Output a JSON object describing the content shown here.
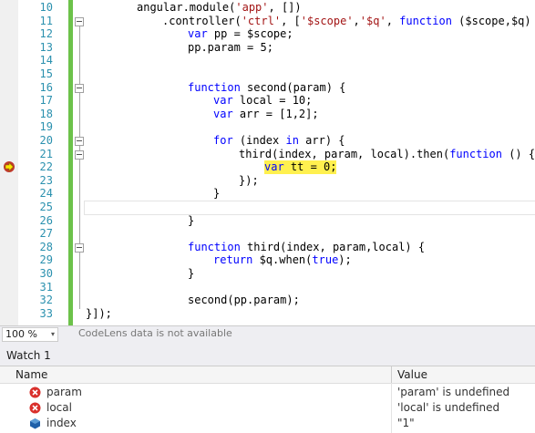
{
  "editor": {
    "lines": [
      {
        "n": "10"
      },
      {
        "n": "11"
      },
      {
        "n": "12"
      },
      {
        "n": "13"
      },
      {
        "n": "14"
      },
      {
        "n": "15"
      },
      {
        "n": "16"
      },
      {
        "n": "17"
      },
      {
        "n": "18"
      },
      {
        "n": "19"
      },
      {
        "n": "20"
      },
      {
        "n": "21"
      },
      {
        "n": "22"
      },
      {
        "n": "23"
      },
      {
        "n": "24"
      },
      {
        "n": "25"
      },
      {
        "n": "26"
      },
      {
        "n": "27"
      },
      {
        "n": "28"
      },
      {
        "n": "29"
      },
      {
        "n": "30"
      },
      {
        "n": "31"
      },
      {
        "n": "32"
      },
      {
        "n": "33"
      }
    ],
    "code": {
      "l10": [
        "angular.module(",
        "'app'",
        ", [])"
      ],
      "l11": [
        ".controller(",
        "'ctrl'",
        ", [",
        "'$scope'",
        ",",
        "'$q'",
        ", ",
        "function",
        " ($scope,$q) {"
      ],
      "l12": [
        "var",
        " pp = $scope;"
      ],
      "l13": [
        "pp.param = 5;"
      ],
      "l16": [
        "function",
        " second(param) {"
      ],
      "l17": [
        "var",
        " local = 10;"
      ],
      "l18": [
        "var",
        " arr = [1,2];"
      ],
      "l20": [
        "for",
        " (index ",
        "in",
        " arr) {"
      ],
      "l21": [
        "third(index, param, local).then(",
        "function",
        " () {"
      ],
      "l22": [
        "var",
        " tt = 0;"
      ],
      "l23": [
        "});"
      ],
      "l24": [
        "}"
      ],
      "l26": [
        "}"
      ],
      "l28": [
        "function",
        " third(index, param,local) {"
      ],
      "l29": [
        "return",
        " $q.when(",
        "true",
        ");"
      ],
      "l30": [
        "}"
      ],
      "l32": [
        "second(pp.param);"
      ],
      "l33": [
        "}]);"
      ]
    }
  },
  "statusbar": {
    "zoom": "100 %",
    "dropdown_glyph": "▾",
    "codelens": "CodeLens data is not available"
  },
  "watch": {
    "title": "Watch 1",
    "columns": {
      "name": "Name",
      "value": "Value"
    },
    "rows": [
      {
        "name": "param",
        "value": "'param' is undefined",
        "icon": "error-icon"
      },
      {
        "name": "local",
        "value": "'local' is undefined",
        "icon": "error-icon"
      },
      {
        "name": "index",
        "value": "\"1\"",
        "icon": "variable-icon"
      }
    ]
  },
  "colors": {
    "keyword": "#0000ff",
    "string": "#a31515",
    "line_number": "#2b91af",
    "change_bar": "#6cc24a",
    "highlight": "#fff04f"
  }
}
